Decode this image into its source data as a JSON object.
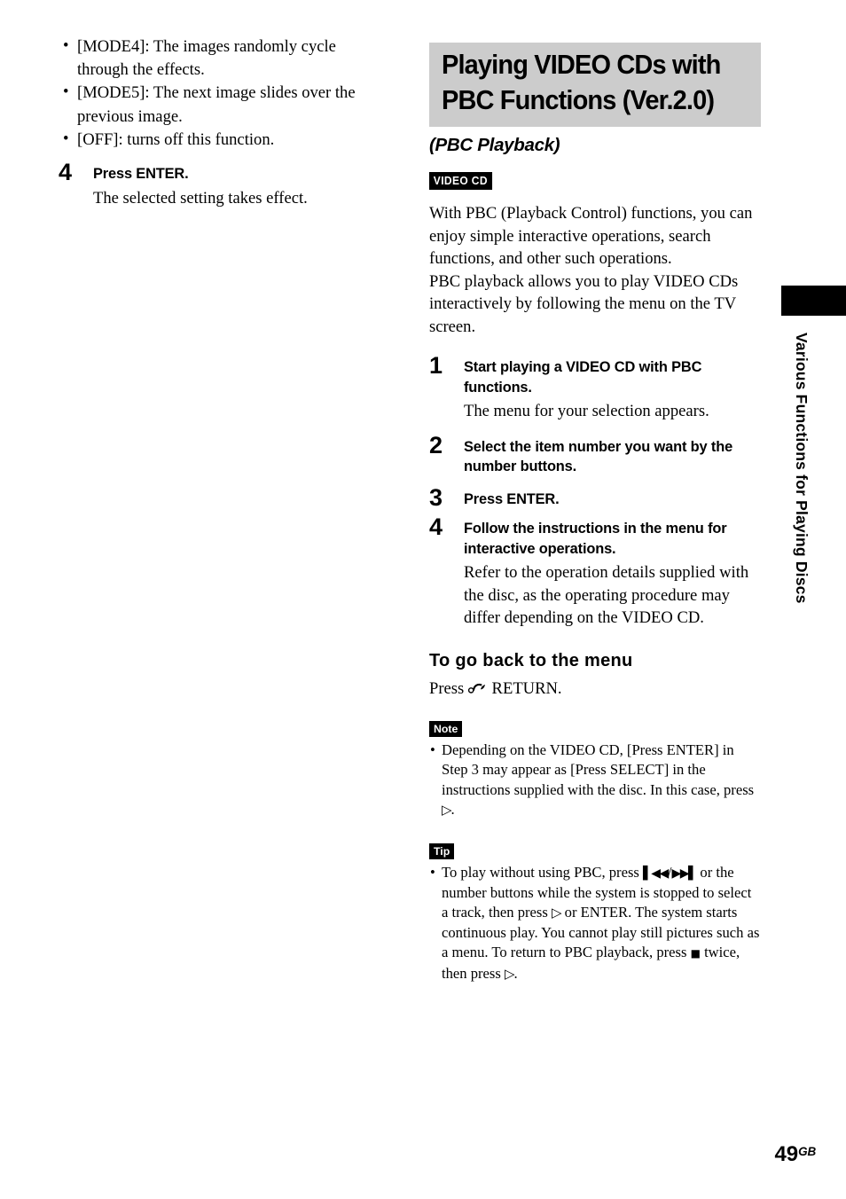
{
  "left_column": {
    "bullets": [
      "[MODE4]: The images randomly cycle through the effects.",
      "[MODE5]: The next image slides over the previous image.",
      "[OFF]: turns off this function."
    ],
    "step": {
      "number": "4",
      "heading": "Press ENTER.",
      "body": "The selected setting takes effect."
    }
  },
  "right_column": {
    "title": "Playing VIDEO CDs with PBC Functions (Ver.2.0)",
    "subtitle": "(PBC Playback)",
    "disc_badge": "VIDEO CD",
    "paragraphs": [
      "With PBC (Playback Control) functions, you can enjoy simple interactive operations, search functions, and other such operations.",
      "PBC playback allows you to play VIDEO CDs interactively by following the menu on the TV screen."
    ],
    "steps": [
      {
        "number": "1",
        "heading": "Start playing a VIDEO CD with PBC functions.",
        "body": "The menu for your selection appears."
      },
      {
        "number": "2",
        "heading": "Select the item number you want by the number buttons.",
        "body": ""
      },
      {
        "number": "3",
        "heading": "Press ENTER.",
        "body": ""
      },
      {
        "number": "4",
        "heading": "Follow the instructions in the menu for interactive operations.",
        "body": "Refer to the operation details supplied with the disc, as the operating procedure may differ depending on the VIDEO CD."
      }
    ],
    "subheading": "To go back to the menu",
    "subheading_body_pre": "Press ",
    "subheading_body_post": " RETURN.",
    "note": {
      "badge": "Note",
      "text_1": "Depending on the VIDEO CD, [Press ENTER] in Step 3 may appear as [Press SELECT] in the instructions supplied with the disc. In this case, press ",
      "glyph_1": "▷",
      "text_2": "."
    },
    "tip": {
      "badge": "Tip",
      "text_1": "To play without using PBC, press ",
      "glyph_skip_prev": "▌◀◀",
      "text_sep": "/",
      "glyph_skip_next": "▶▶▌",
      "text_2": " or the number buttons while the system is stopped to select a track, then press ",
      "glyph_play_1": "▷",
      "text_3": " or ENTER. The system starts continuous play. You cannot play still pictures such as a menu. To return to PBC playback, press ",
      "glyph_stop": "■",
      "text_4": " twice, then press ",
      "glyph_play_2": "▷",
      "text_5": "."
    }
  },
  "side_tab": {
    "label": "Various Functions for Playing Discs"
  },
  "footer": {
    "page_number": "49",
    "page_suffix": "GB"
  },
  "colors": {
    "title_band": "#cccccc",
    "badge_bg": "#000000",
    "badge_fg": "#ffffff",
    "text": "#000000"
  }
}
